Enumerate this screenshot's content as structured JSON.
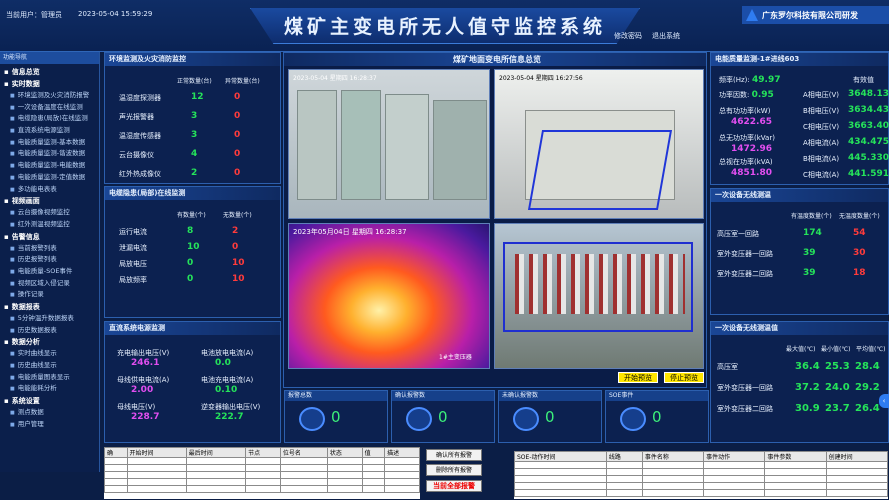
{
  "header": {
    "user": "当前用户：管理员",
    "datetime": "2023-05-04 15:59:29",
    "title": "煤矿主变电所无人值守监控系统",
    "change_password": "修改密码",
    "logout": "退出系统",
    "company": "广东罗尔科技有限公司研发"
  },
  "sidebar": {
    "header": "功能导航",
    "groups": [
      {
        "label": "信息总览",
        "items": []
      },
      {
        "label": "实时数据",
        "items": [
          "环境监测及火灾消防报警",
          "一次设备温度在线监测",
          "电缆隐患(局放)在线监测",
          "直流系统电源监测",
          "电能质量监测-基本数据",
          "电能质量监测-谐波数据",
          "电能质量监测-电能数据",
          "电能质量监测-定值数据",
          "多功能电表表"
        ]
      },
      {
        "label": "视频画面",
        "items": [
          "云台摄像视频监控",
          "红外测温视频监控"
        ]
      },
      {
        "label": "告警信息",
        "items": [
          "当前报警列表",
          "历史报警列表",
          "电能质量-SOE事件",
          "视频区域入侵记录",
          "操作记录"
        ]
      },
      {
        "label": "数据报表",
        "items": [
          "5分钟温升数据报表",
          "历史数据报表"
        ]
      },
      {
        "label": "数据分析",
        "items": [
          "实时曲线显示",
          "历史曲线显示",
          "电能质量图表显示",
          "电能能耗分析"
        ]
      },
      {
        "label": "系统设置",
        "items": [
          "测点数据",
          "用户管理"
        ]
      }
    ]
  },
  "env": {
    "title": "环境监测及火灾消防监控",
    "col_normal": "正常数量(台)",
    "col_abnormal": "异常数量(台)",
    "rows": [
      {
        "name": "温湿度探测器",
        "normal": "12",
        "abnormal": "0"
      },
      {
        "name": "声光报警器",
        "normal": "3",
        "abnormal": "0"
      },
      {
        "name": "温湿度传感器",
        "normal": "3",
        "abnormal": "0"
      },
      {
        "name": "云台摄像仪",
        "normal": "4",
        "abnormal": "0"
      },
      {
        "name": "红外热成像仪",
        "normal": "2",
        "abnormal": "0"
      }
    ]
  },
  "cable": {
    "title": "电缆隐患(局部)在线监测",
    "col_have": "有数量(个)",
    "col_none": "无数量(个)",
    "rows": [
      {
        "name": "运行电流",
        "have": "8",
        "none": "2"
      },
      {
        "name": "泄漏电流",
        "have": "10",
        "none": "0"
      },
      {
        "name": "局放电压",
        "have": "0",
        "none": "10"
      },
      {
        "name": "局放频率",
        "have": "0",
        "none": "10"
      }
    ]
  },
  "dc": {
    "title": "直流系统电源监测",
    "items": [
      {
        "label": "充电输出电压(V)",
        "value": "246.1",
        "color": "#e24ef0"
      },
      {
        "label": "电池放电电流(A)",
        "value": "0.0",
        "color": "#25e35a"
      },
      {
        "label": "母线供电电流(A)",
        "value": "2.00",
        "color": "#e24ef0"
      },
      {
        "label": "电池充电电流(A)",
        "value": "0.10",
        "color": "#25e35a"
      },
      {
        "label": "母线电压(V)",
        "value": "228.7",
        "color": "#e24ef0"
      },
      {
        "label": "逆变器输出电压(V)",
        "value": "222.7",
        "color": "#25e35a"
      }
    ]
  },
  "video": {
    "title": "煤矿地面变电所信息总览",
    "cam1_time": "2023-05-04 星期四 16:28:37",
    "cam2_time": "2023-05-04 星期四 16:27:56",
    "cam3_time": "2023年05月04日 星期四 16:28:37",
    "cam3_label": "1#主变压器",
    "start_btn": "开始预览",
    "stop_btn": "停止预览"
  },
  "alarms": [
    {
      "label": "报警总数",
      "value": "0"
    },
    {
      "label": "确认报警数",
      "value": "0"
    },
    {
      "label": "未确认报警数",
      "value": "0"
    },
    {
      "label": "SOE事件",
      "value": "0"
    }
  ],
  "power": {
    "title": "电能质量监测-1#进线603",
    "freq_label": "频率(Hz):",
    "freq": "49.97",
    "valid_label": "有效值",
    "pf_label": "功率因数:",
    "pf": "0.95",
    "active_label": "总有功功率(kW)",
    "active": "4622.65",
    "reactive_label": "总无功功率(kVar)",
    "reactive": "1472.96",
    "apparent_label": "总视在功率(kVA)",
    "apparent": "4851.80",
    "phases": [
      {
        "label": "A相电压(V)",
        "value": "3648.13"
      },
      {
        "label": "B相电压(V)",
        "value": "3634.43"
      },
      {
        "label": "C相电压(V)",
        "value": "3663.40"
      },
      {
        "label": "A相电流(A)",
        "value": "434.475"
      },
      {
        "label": "B相电流(A)",
        "value": "445.330"
      },
      {
        "label": "C相电流(A)",
        "value": "441.591"
      }
    ]
  },
  "wireless": {
    "title": "一次设备无线测温",
    "col_normal": "有温度数量(个)",
    "col_none": "无温度数量(个)",
    "rows": [
      {
        "name": "高压室一回路",
        "normal": "174",
        "none": "54"
      },
      {
        "name": "室外变压器一回路",
        "normal": "39",
        "none": "30"
      },
      {
        "name": "室外变压器二回路",
        "normal": "39",
        "none": "18"
      }
    ]
  },
  "temps": {
    "title": "一次设备无线测温值",
    "cols": [
      "最大值(℃)",
      "最小值(℃)",
      "平均值(℃)"
    ],
    "rows": [
      {
        "name": "高压室",
        "max": "36.4",
        "min": "25.3",
        "avg": "28.4"
      },
      {
        "name": "室外变压器一回路",
        "max": "37.2",
        "min": "24.0",
        "avg": "29.2"
      },
      {
        "name": "室外变压器二回路",
        "max": "30.9",
        "min": "23.7",
        "avg": "26.4"
      }
    ]
  },
  "events": {
    "headers": [
      "确",
      "开始时间",
      "最后时间",
      "节点",
      "位号名",
      "状态",
      "值",
      "描述"
    ],
    "confirm_all": "确认所有报警",
    "delete_all": "删除所有报警",
    "current_all": "当前全部报警",
    "soe_headers": [
      "SOE-动作时间",
      "线路",
      "事件名称",
      "事件动作",
      "事件参数",
      "创建时间"
    ]
  },
  "colors": {
    "bg": "#0b1e46",
    "panel_head": "#1a4696",
    "green": "#25e35a",
    "red": "#ff3b3b",
    "yellow": "#ffd43b",
    "magenta": "#e24ef0",
    "cyan": "#3cf0e8"
  }
}
